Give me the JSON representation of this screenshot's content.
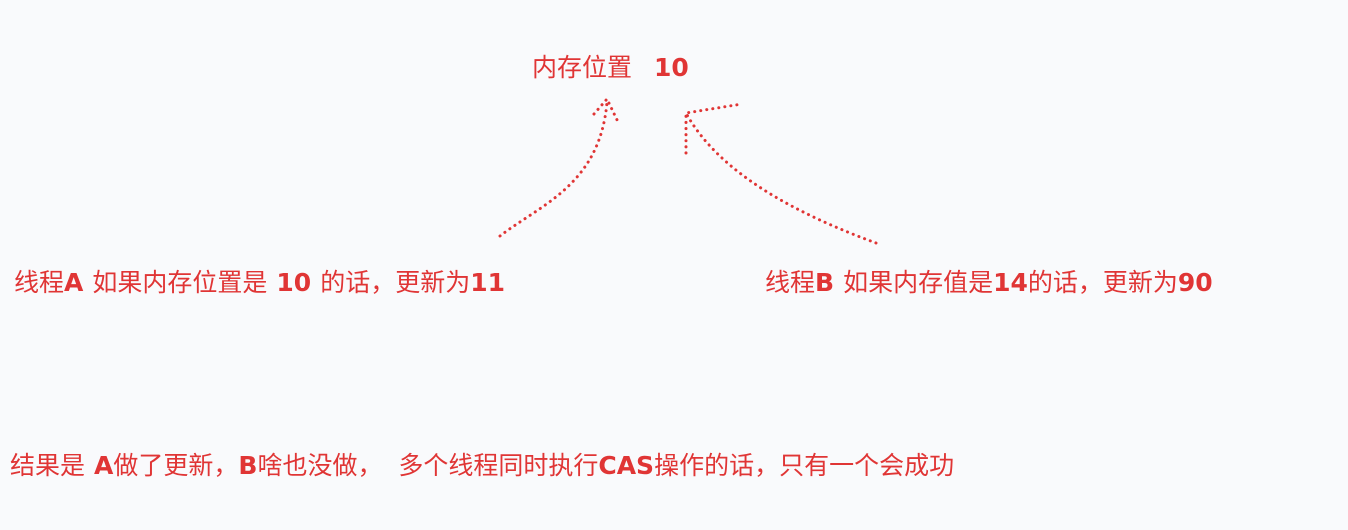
{
  "memory": {
    "text": "内存位置",
    "value": "10"
  },
  "thread_a": {
    "name_prefix": "线程",
    "name_letter": "A",
    "cond_prefix": "如果内存位置是",
    "cond_value": "10",
    "cond_suffix": "的话，更新为",
    "new_value": "11"
  },
  "thread_b": {
    "name_prefix": "线程",
    "name_letter": "B",
    "cond_prefix": "如果内存值是",
    "cond_value": "14",
    "cond_suffix": "的话，更新为",
    "new_value": "90"
  },
  "result": {
    "prefix": "结果是",
    "a": "A",
    "a_text": "做了更新，",
    "b": "B",
    "b_text": "啥也没做，  多个线程同时执行",
    "cas": "CAS",
    "tail": "操作的话，只有一个会成功"
  },
  "colors": {
    "accent": "#e03535",
    "background": "#f9fafc"
  }
}
